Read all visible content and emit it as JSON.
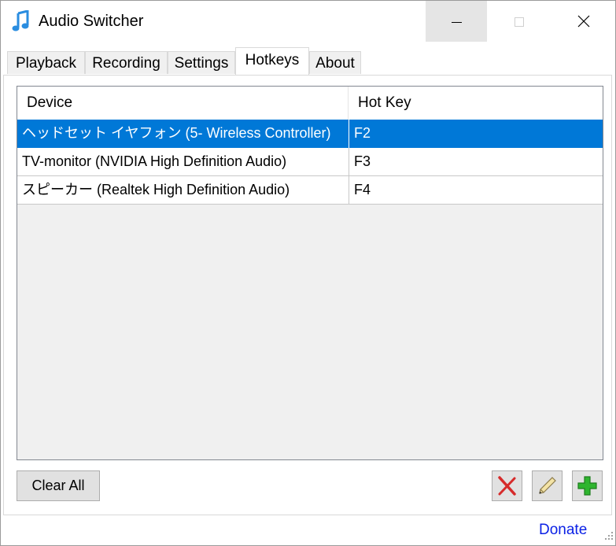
{
  "window": {
    "title": "Audio Switcher",
    "app_icon": "music-note-icon",
    "controls": [
      "minimize-icon",
      "maximize-icon",
      "close-icon"
    ]
  },
  "tabs": [
    {
      "label": "Playback",
      "active": false
    },
    {
      "label": "Recording",
      "active": false
    },
    {
      "label": "Settings",
      "active": false
    },
    {
      "label": "Hotkeys",
      "active": true
    },
    {
      "label": "About",
      "active": false
    }
  ],
  "hotkeys_table": {
    "columns": [
      "Device",
      "Hot Key"
    ],
    "rows": [
      {
        "device": "ヘッドセット イヤフォン (5- Wireless Controller)",
        "hotkey": "F2",
        "selected": true
      },
      {
        "device": "TV-monitor (NVIDIA High Definition Audio)",
        "hotkey": "F3",
        "selected": false
      },
      {
        "device": "スピーカー (Realtek High Definition Audio)",
        "hotkey": "F4",
        "selected": false
      }
    ]
  },
  "buttons": {
    "clear_all": "Clear All",
    "delete_icon": "red-x-icon",
    "edit_icon": "pencil-icon",
    "add_icon": "green-plus-icon"
  },
  "footer": {
    "donate": "Donate"
  },
  "colors": {
    "selection": "#0078d7",
    "link": "#0b21e6",
    "delete": "#d62b2b",
    "add": "#2fb52f"
  }
}
